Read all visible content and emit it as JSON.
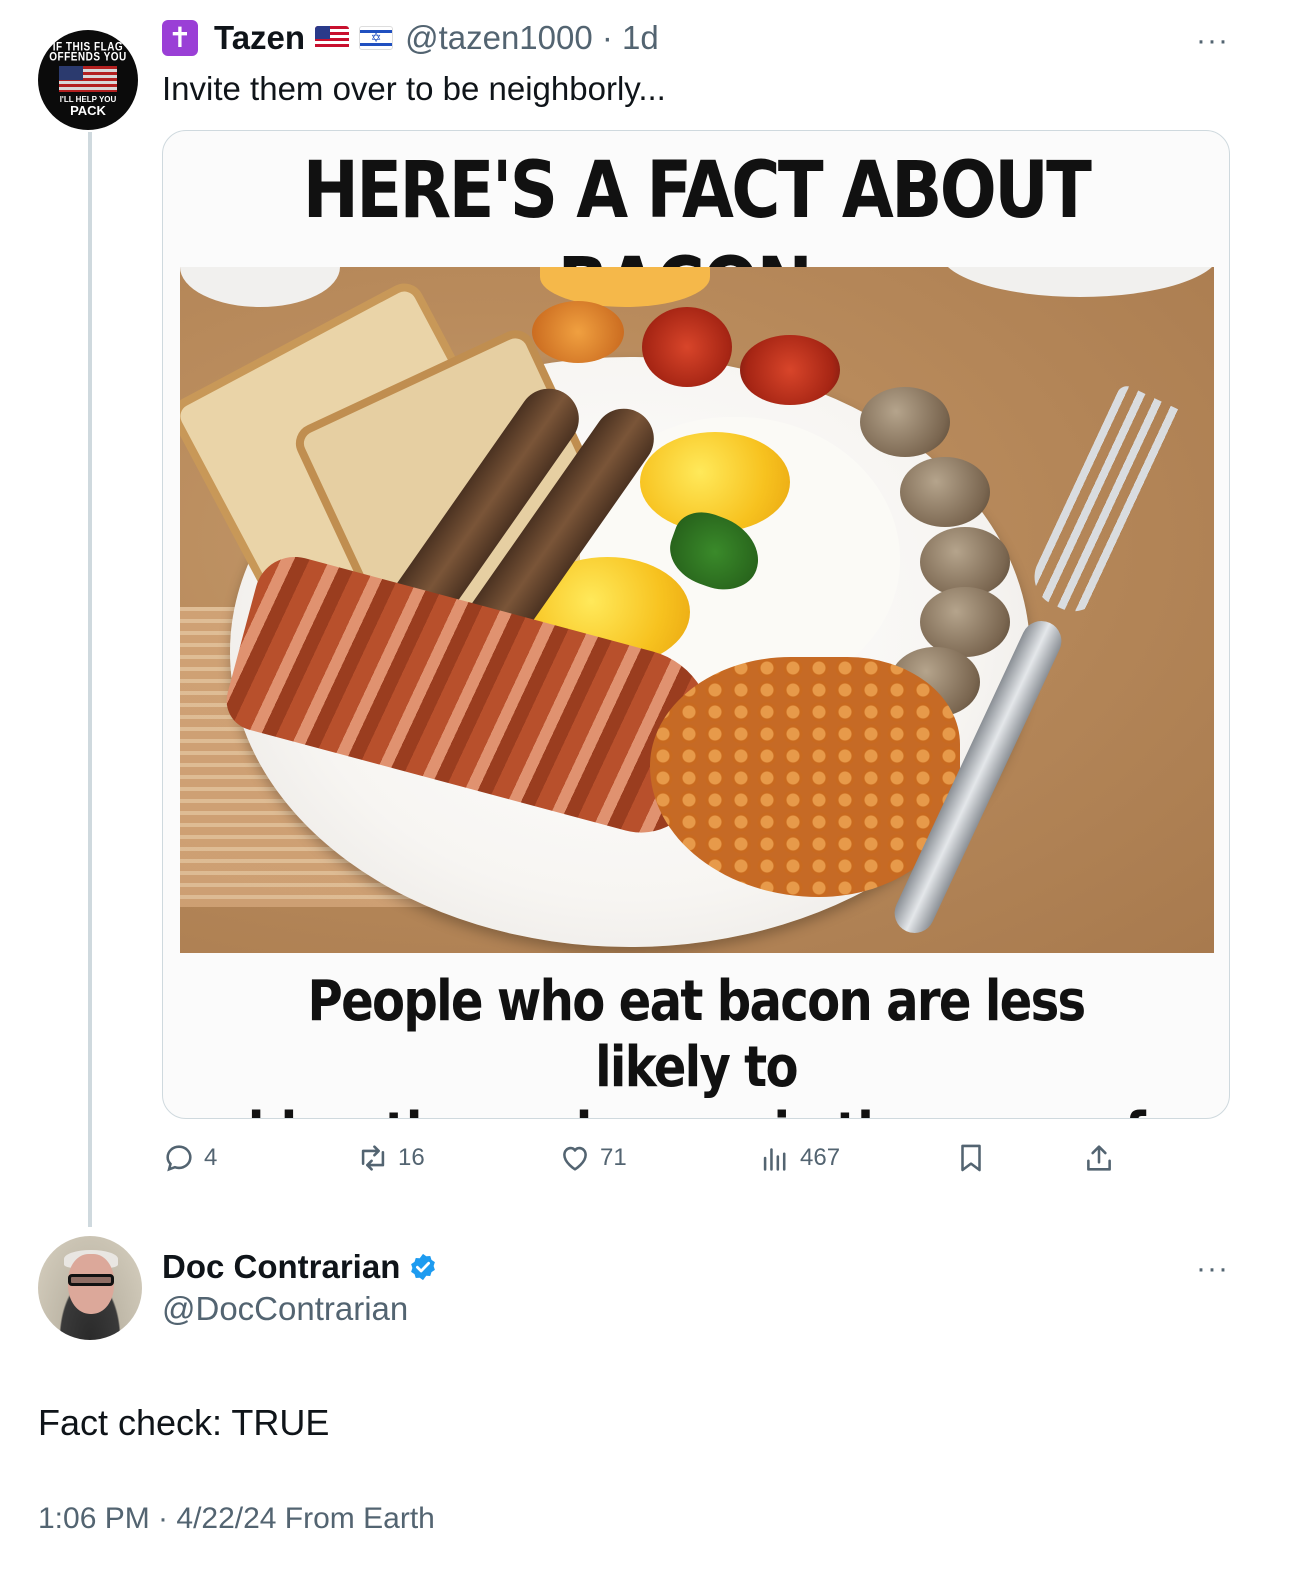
{
  "tweet": {
    "avatar_text": {
      "line1": "IF THIS FLAG",
      "line2": "OFFENDS YOU",
      "line3": "I'LL HELP YOU",
      "line4": "PACK"
    },
    "badge_icon": "latin-cross-icon",
    "author_name": "Tazen",
    "flags": [
      "us-flag-icon",
      "israel-flag-icon"
    ],
    "handle_time": "@tazen1000 · 1d",
    "more_label": "···",
    "text": "Invite them over to be neighborly...",
    "media": {
      "title": "HERE'S A FACT ABOUT BACON:",
      "caption_line1": "People who eat bacon are less likely to",
      "caption_line2": "blow themselves up in the name of allah."
    },
    "actions": {
      "replies": "4",
      "reposts": "16",
      "likes": "71",
      "views": "467"
    }
  },
  "reply": {
    "author_name": "Doc Contrarian",
    "verified_icon": "verified-badge-icon",
    "handle": "@DocContrarian",
    "more_label": "···",
    "text": "Fact check: TRUE",
    "meta": "1:06 PM · 4/22/24 From Earth"
  },
  "colors": {
    "text_primary": "#0f1419",
    "text_secondary": "#536471",
    "verified_blue": "#1d9bf0",
    "border": "#cfd9de"
  }
}
